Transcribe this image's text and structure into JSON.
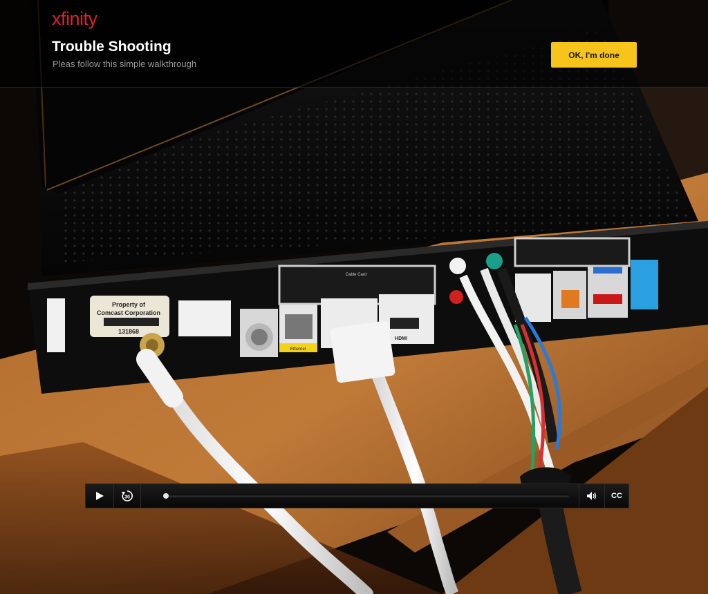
{
  "header": {
    "logo": "xfinity",
    "title": "Trouble Shooting",
    "subtitle": "Pleas follow this simple walkthrough",
    "done_button": "OK, I'm done"
  },
  "video": {
    "scene_labels": {
      "property_tag_line1": "Property of",
      "property_tag_line2": "Comcast Corporation",
      "property_tag_number": "131868",
      "cable_card": "Cable Card",
      "ethernet": "Ethernet",
      "hdmi": "HDMI"
    }
  },
  "player": {
    "play_icon": "play-icon",
    "rewind_label": "30",
    "rewind_icon": "rewind-30-icon",
    "progress": 0.0,
    "volume_icon": "volume-icon",
    "cc_label": "CC"
  },
  "colors": {
    "brand": "#e0212c",
    "accent_button": "#f7c41b"
  }
}
